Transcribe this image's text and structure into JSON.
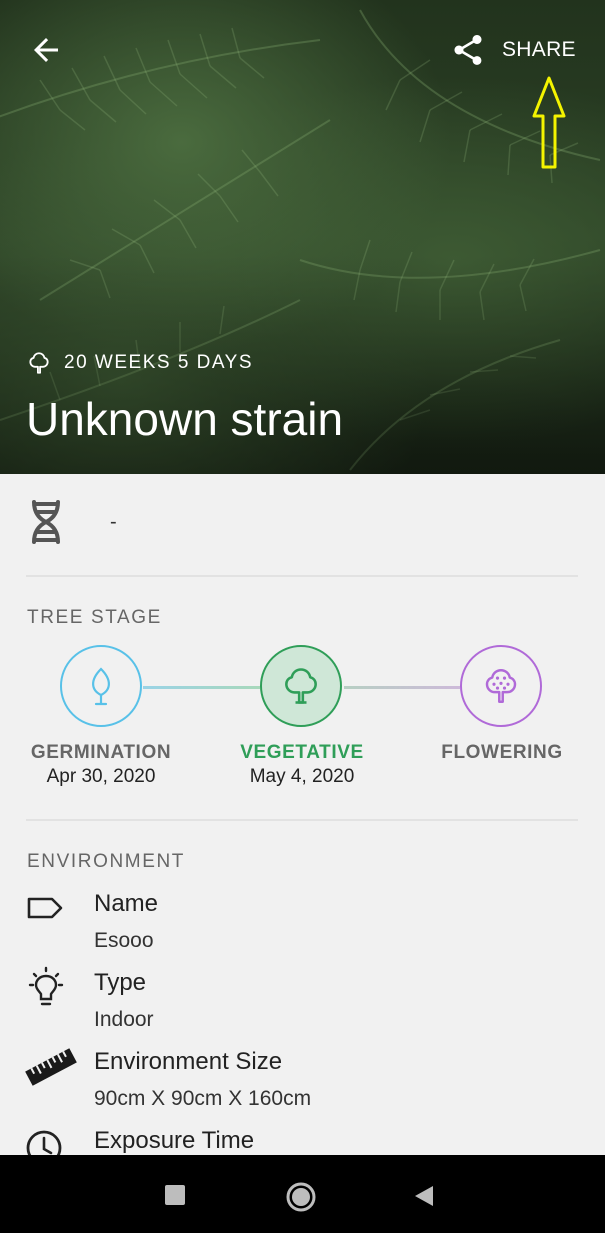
{
  "header": {
    "share_label": "SHARE",
    "age": "20 WEEKS 5 DAYS",
    "title": "Unknown strain"
  },
  "genetics": {
    "value": "-"
  },
  "tree_stage": {
    "section_title": "TREE STAGE",
    "stages": [
      {
        "name": "GERMINATION",
        "date": "Apr 30, 2020",
        "color": "#58c1e8"
      },
      {
        "name": "VEGETATIVE",
        "date": "May 4, 2020",
        "color": "#2f9e58",
        "active": true
      },
      {
        "name": "FLOWERING",
        "date": "",
        "color": "#b06ad8"
      }
    ]
  },
  "environment": {
    "section_title": "ENVIRONMENT",
    "items": [
      {
        "label": "Name",
        "value": "Esooo",
        "icon": "tag-icon"
      },
      {
        "label": "Type",
        "value": "Indoor",
        "icon": "bulb-icon"
      },
      {
        "label": "Environment Size",
        "value": "90cm X 90cm X 160cm",
        "icon": "ruler-icon"
      },
      {
        "label": "Exposure Time",
        "value": "",
        "icon": "clock-icon"
      }
    ]
  },
  "colors": {
    "accent_green": "#2f9e58",
    "annotation_arrow": "#f4f400"
  }
}
